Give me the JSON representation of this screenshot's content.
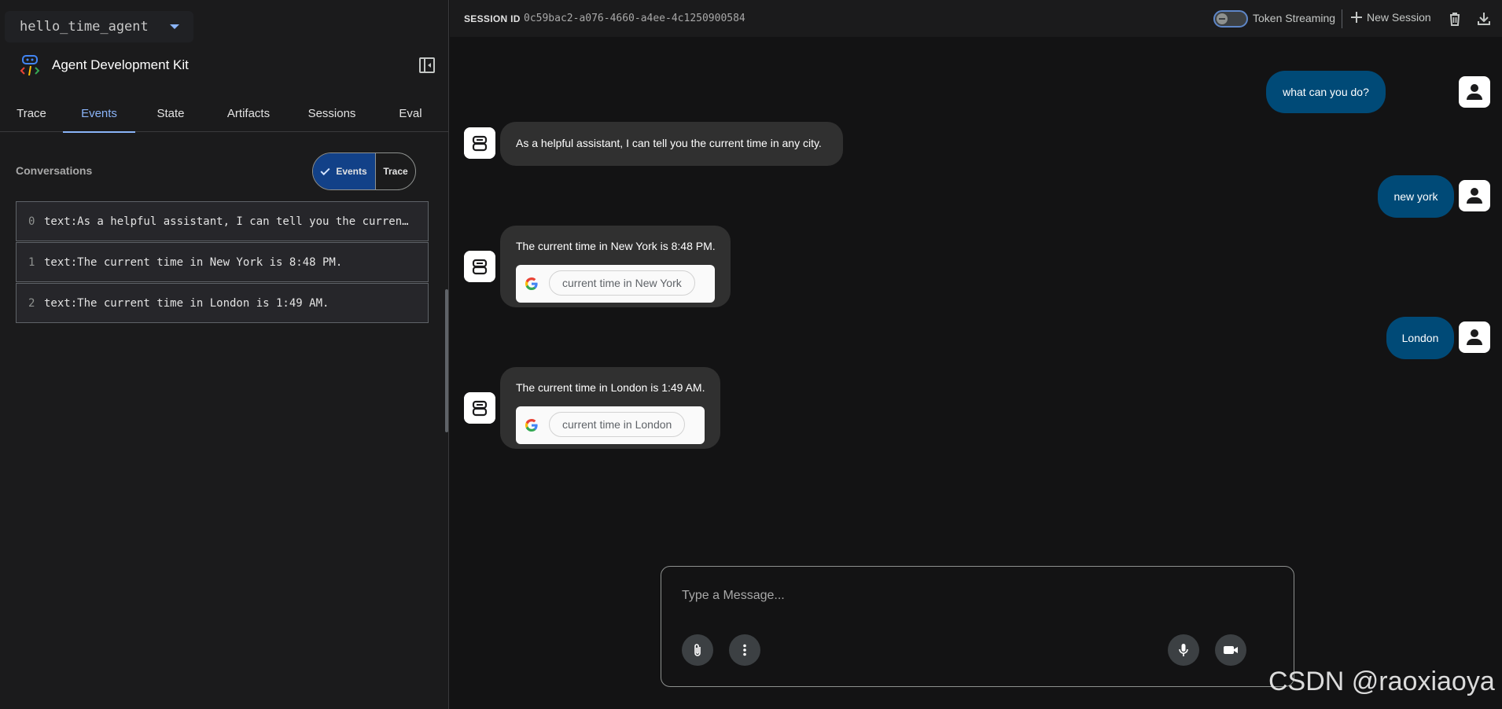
{
  "sidebar": {
    "agent_select": "hello_time_agent",
    "brand_title": "Agent Development Kit",
    "tabs": [
      {
        "label": "Trace"
      },
      {
        "label": "Events"
      },
      {
        "label": "State"
      },
      {
        "label": "Artifacts"
      },
      {
        "label": "Sessions"
      },
      {
        "label": "Eval"
      }
    ],
    "active_tab": "Events",
    "conversations_label": "Conversations",
    "toggle": {
      "events_label": "Events",
      "trace_label": "Trace",
      "selected": "Events"
    },
    "events": [
      {
        "index": "0",
        "text": "text:As a helpful assistant, I can tell you the current time in any city."
      },
      {
        "index": "1",
        "text": "text:The current time in New York is 8:48 PM."
      },
      {
        "index": "2",
        "text": "text:The current time in London is 1:49 AM."
      }
    ]
  },
  "topbar": {
    "session_label": "SESSION ID",
    "session_id": "0c59bac2-a076-4660-a4ee-4c1250900584",
    "token_streaming_label": "Token Streaming",
    "new_session_label": "New Session"
  },
  "chat": {
    "messages": [
      {
        "role": "user",
        "text": "what can you do?"
      },
      {
        "role": "bot",
        "text": "As a helpful assistant, I can tell you the current time in any city."
      },
      {
        "role": "user",
        "text": "new york"
      },
      {
        "role": "bot",
        "text": "The current time in New York is 8:48 PM.",
        "search": "current time in New York"
      },
      {
        "role": "user",
        "text": "London"
      },
      {
        "role": "bot",
        "text": "The current time in London is 1:49 AM.",
        "search": "current time in London"
      }
    ],
    "composer_placeholder": "Type a Message..."
  },
  "icons": {
    "attach": "paperclip-icon",
    "more": "more-vert-icon",
    "mic": "mic-icon",
    "video": "videocam-icon",
    "trash": "delete-icon",
    "download": "download-icon"
  },
  "colors": {
    "accent": "#8ab4f8",
    "user_bubble": "#004a77",
    "bot_bubble": "#303030",
    "toggle_selected": "#124188"
  },
  "watermark": "CSDN @raoxiaoya"
}
